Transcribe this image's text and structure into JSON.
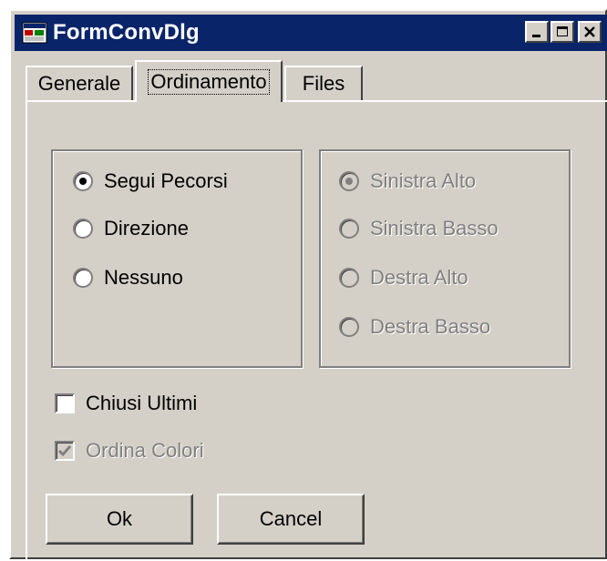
{
  "window": {
    "title": "FormConvDlg"
  },
  "tabs": [
    {
      "label": "Generale",
      "active": false
    },
    {
      "label": "Ordinamento",
      "active": true
    },
    {
      "label": "Files",
      "active": false
    }
  ],
  "left_group": {
    "options": [
      {
        "label": "Segui Pecorsi",
        "checked": true
      },
      {
        "label": "Direzione",
        "checked": false
      },
      {
        "label": "Nessuno",
        "checked": false
      }
    ]
  },
  "right_group": {
    "disabled": true,
    "options": [
      {
        "label": "Sinistra Alto",
        "checked": true
      },
      {
        "label": "Sinistra Basso",
        "checked": false
      },
      {
        "label": "Destra Alto",
        "checked": false
      },
      {
        "label": "Destra Basso",
        "checked": false
      }
    ]
  },
  "checkboxes": {
    "chiusi_ultimi": {
      "label": "Chiusi Ultimi",
      "checked": false,
      "disabled": false
    },
    "ordina_colori": {
      "label": "Ordina Colori",
      "checked": true,
      "disabled": true
    }
  },
  "buttons": {
    "ok": "Ok",
    "cancel": "Cancel"
  },
  "colors": {
    "titlebar": "#0a246a",
    "face": "#d4d0c8",
    "disabled_text": "#808080"
  }
}
